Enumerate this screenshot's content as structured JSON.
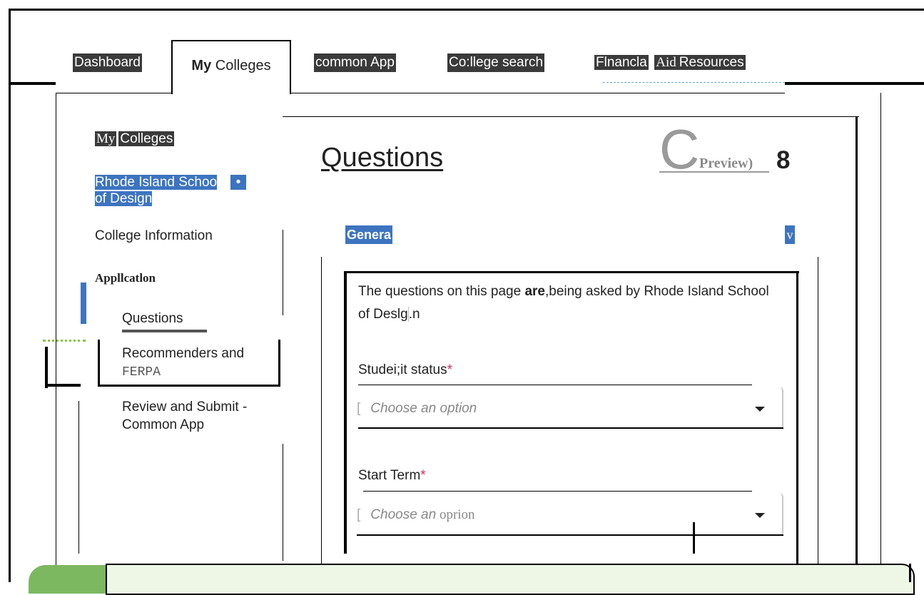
{
  "nav": {
    "tabs": [
      {
        "label": "Dashboard"
      },
      {
        "label_bold": "My",
        "label_rest": " Colleges"
      },
      {
        "label": "common App"
      },
      {
        "label": "Co:llege search"
      },
      {
        "label_a": "Flnancla",
        "label_b": "Aid",
        "label_c": "Resources"
      }
    ]
  },
  "sidebar": {
    "crumb_a": "My",
    "crumb_b": "Colleges",
    "college_line1": "Rhode Island Schoo",
    "college_bullet": "•",
    "college_line2": "of Design",
    "college_info": "College Information",
    "application_heading": "Appllcatlon",
    "items": [
      {
        "label": "Questions"
      },
      {
        "label_a": "Recommenders and",
        "label_b": "FERPA"
      },
      {
        "label_a": "Review and Submit -",
        "label_b": "Common App"
      }
    ]
  },
  "main": {
    "title": "Questions",
    "preview_letter": "C",
    "preview_label": "Preview)",
    "count": "8",
    "section_label": "Genera",
    "section_chevron": "v",
    "intro_a": "The questions on this page ",
    "intro_bold": "are",
    "intro_b": ",being asked by Rhode Island School of Deslg",
    "intro_c": ".n",
    "fields": [
      {
        "label": "Studei;it status",
        "required": "*",
        "bracket": "[",
        "placeholder": "Choose an option"
      },
      {
        "label": "Start Term",
        "required": "*",
        "bracket": "[",
        "placeholder_a": "Choose an",
        "placeholder_b": " oprion"
      }
    ]
  }
}
